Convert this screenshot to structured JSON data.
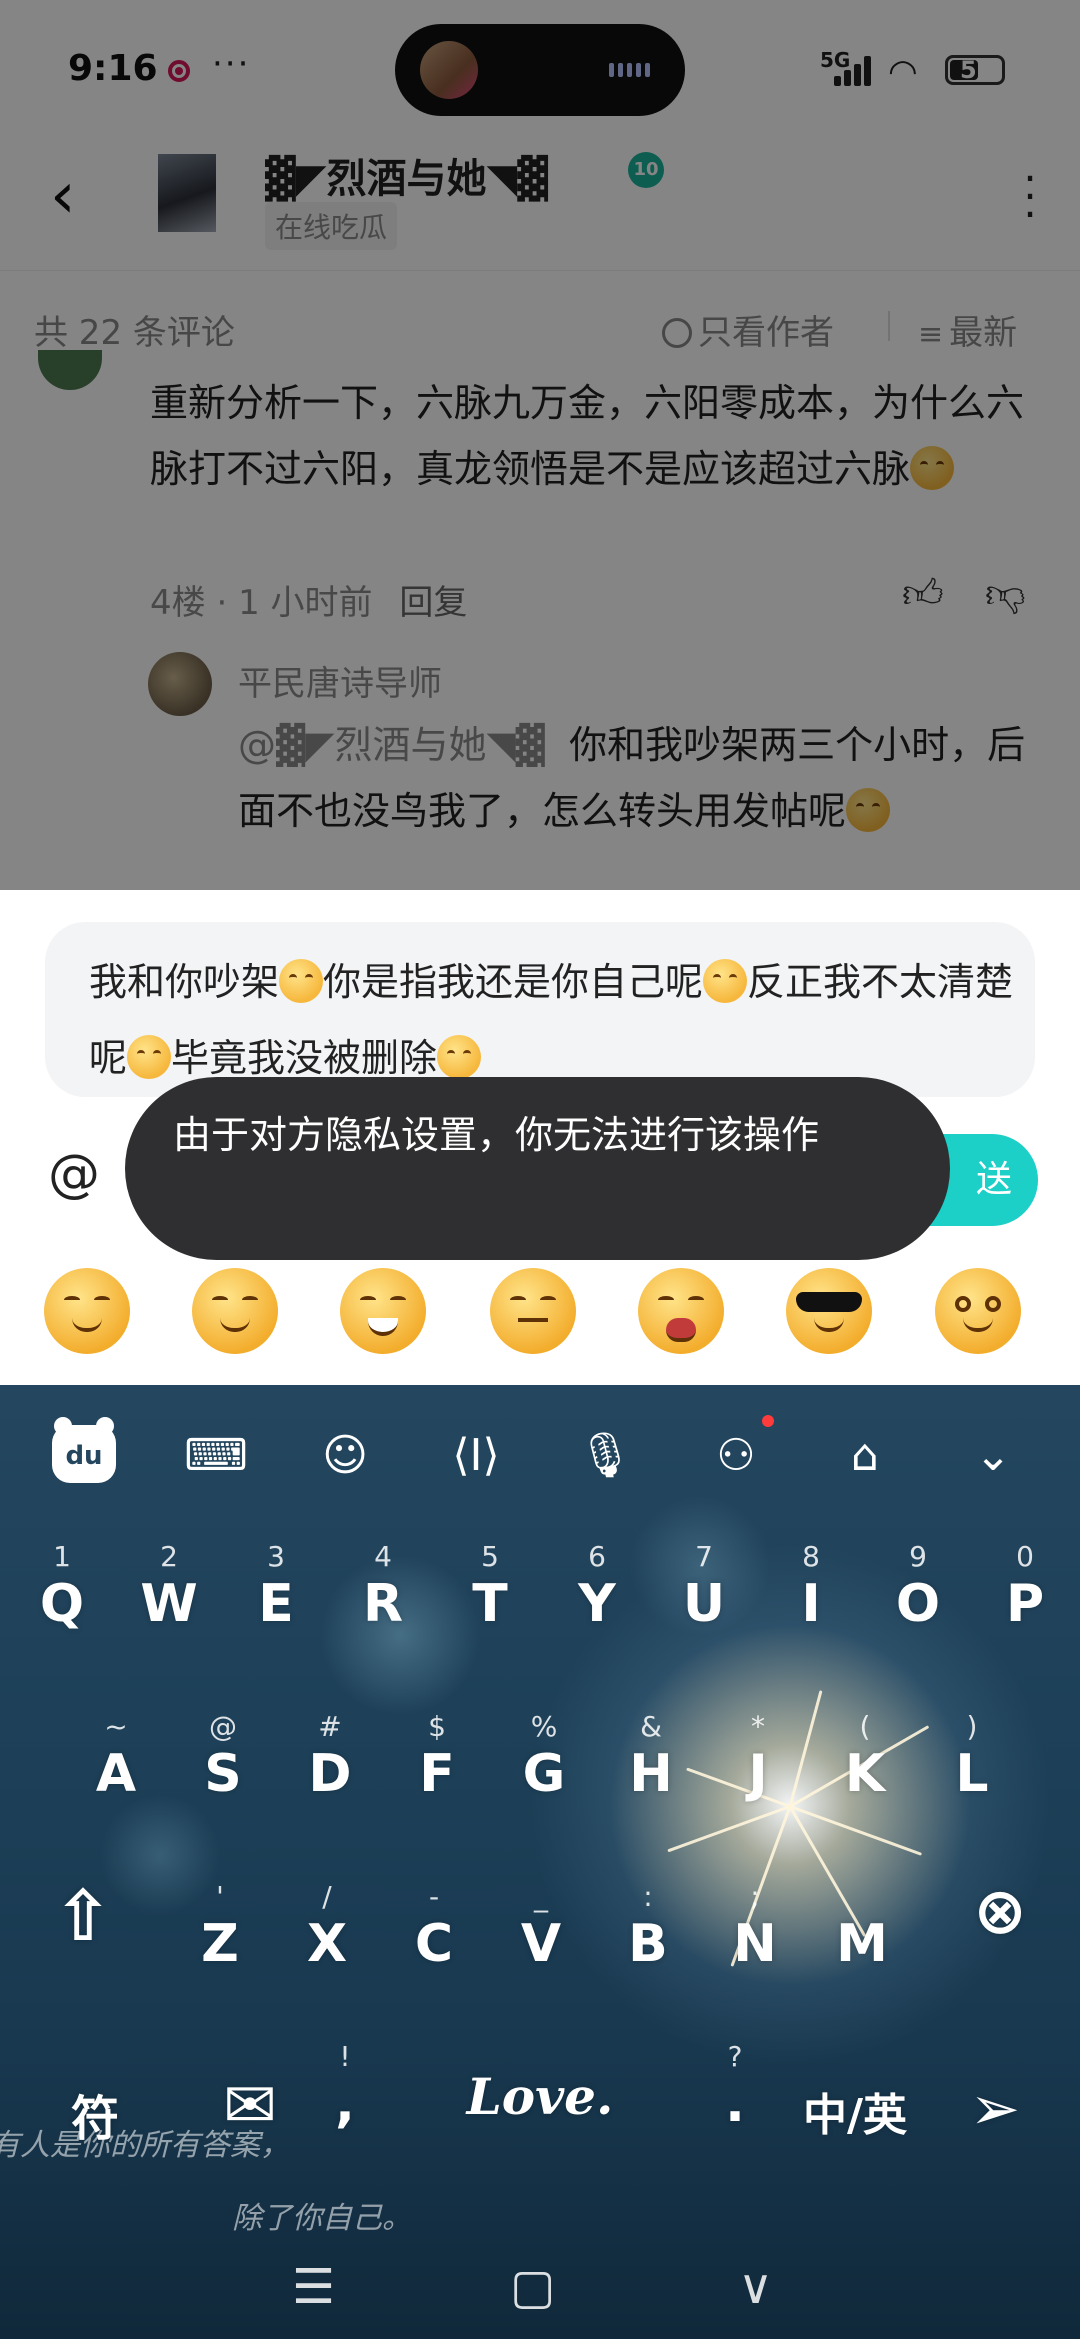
{
  "status_bar": {
    "time": "9:16",
    "more": "···",
    "network": "5G",
    "battery": "51"
  },
  "app_bar": {
    "username": "▓◤烈酒与她◥▓",
    "level": "10",
    "status_tag": "在线吃瓜"
  },
  "filter_bar": {
    "comment_count": "共 22 条评论",
    "only_author": "只看作者",
    "sort": "最新"
  },
  "comment": {
    "text": "重新分析一下，六脉九万金，六阳零成本，为什么六脉打不过六阳，真龙领悟是不是应该超过六脉",
    "floor": "4楼",
    "time": "1 小时前",
    "reply": "回复",
    "sub_reply": {
      "author": "平民唐诗导师",
      "mention": "@▓◤烈酒与她◥▓",
      "text": "你和我吵架两三个小时，后面不也没鸟我了，怎么转头用发帖呢"
    }
  },
  "reply_panel": {
    "input_text": "我和你吵架",
    "input_text_2": "你是指我还是你自己呢",
    "input_text_3": "反正我不太清楚呢",
    "input_text_4": "毕竟我没被删除",
    "at_symbol": "@",
    "send_label": "送",
    "toast": "由于对方隐私设置，你无法进行该操作",
    "emoji_row": [
      "smirk-emoji",
      "wink-emoji",
      "grin-emoji",
      "meh-emoji",
      "shout-emoji",
      "sunglasses-emoji",
      "teary-emoji"
    ]
  },
  "keyboard": {
    "logo": "du",
    "row1": [
      {
        "hint": "1",
        "key": "Q"
      },
      {
        "hint": "2",
        "key": "W"
      },
      {
        "hint": "3",
        "key": "E"
      },
      {
        "hint": "4",
        "key": "R"
      },
      {
        "hint": "5",
        "key": "T"
      },
      {
        "hint": "6",
        "key": "Y"
      },
      {
        "hint": "7",
        "key": "U"
      },
      {
        "hint": "8",
        "key": "I"
      },
      {
        "hint": "9",
        "key": "O"
      },
      {
        "hint": "0",
        "key": "P"
      }
    ],
    "row2": [
      {
        "hint": "~",
        "key": "A"
      },
      {
        "hint": "@",
        "key": "S"
      },
      {
        "hint": "#",
        "key": "D"
      },
      {
        "hint": "$",
        "key": "F"
      },
      {
        "hint": "%",
        "key": "G"
      },
      {
        "hint": "&",
        "key": "H"
      },
      {
        "hint": "*",
        "key": "J"
      },
      {
        "hint": "(",
        "key": "K"
      },
      {
        "hint": ")",
        "key": "L"
      }
    ],
    "row3": [
      {
        "hint": "'",
        "key": "Z"
      },
      {
        "hint": "/",
        "key": "X"
      },
      {
        "hint": "-",
        "key": "C"
      },
      {
        "hint": "_",
        "key": "V"
      },
      {
        "hint": ":",
        "key": "B"
      },
      {
        "hint": ";",
        "key": "N"
      },
      {
        "hint": "",
        "key": "M"
      }
    ],
    "symbols_key": "符",
    "punct_hint_1": "!",
    "punct_hint_2": "?",
    "space_label": "Love.",
    "lang_key": "中/英",
    "deco_line_1": "有人是你的所有答案，",
    "deco_line_2": "除了你自己。"
  }
}
